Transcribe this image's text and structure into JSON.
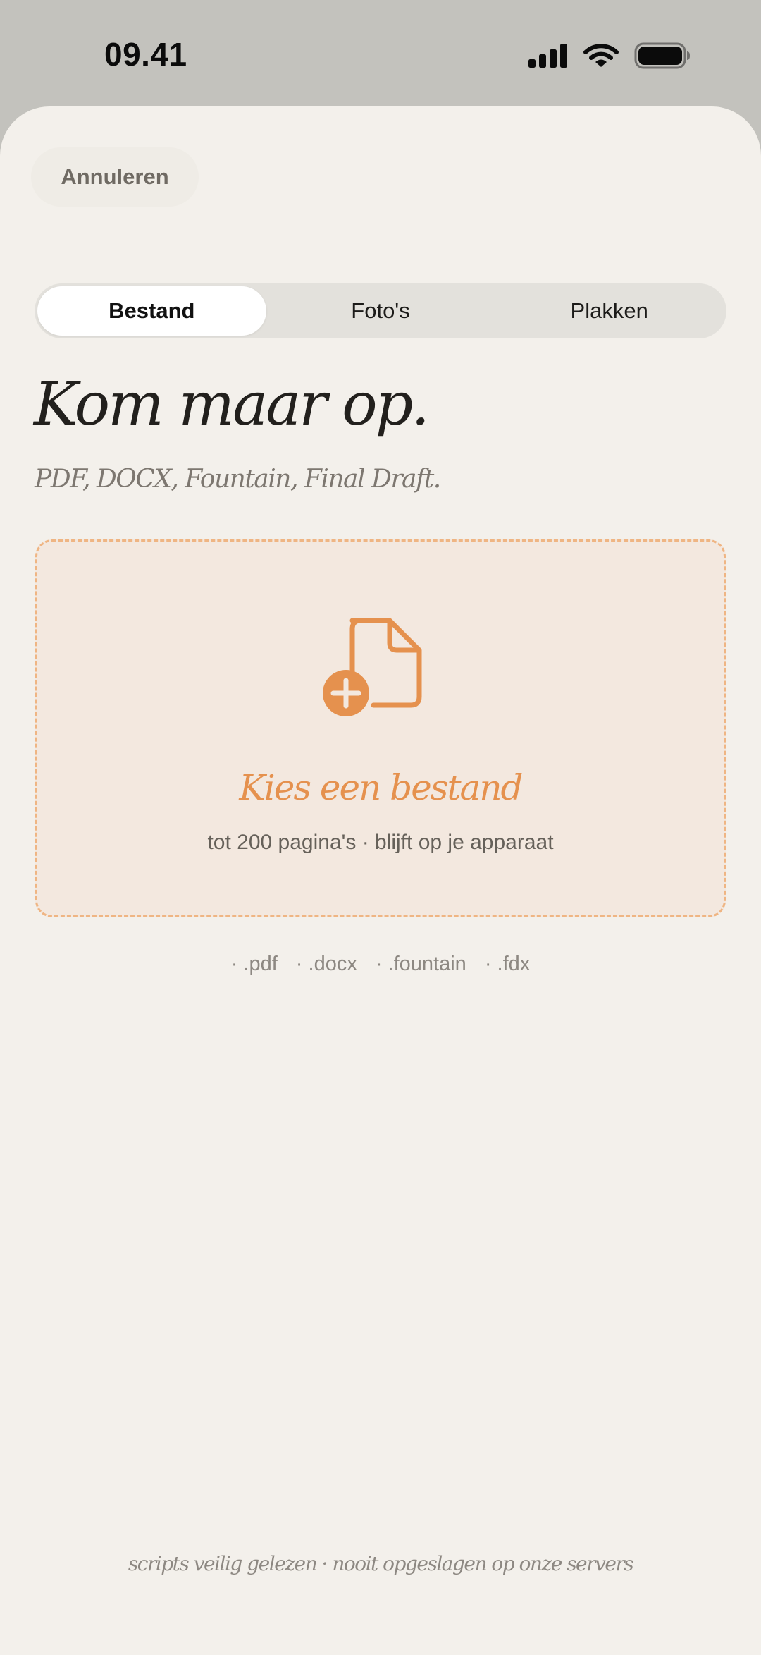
{
  "status_bar": {
    "time": "09.41",
    "icons": [
      "cellular-signal-icon",
      "wifi-icon",
      "battery-icon"
    ]
  },
  "header": {
    "cancel_label": "Annuleren"
  },
  "tabs": [
    {
      "label": "Bestand",
      "active": true
    },
    {
      "label": "Foto's",
      "active": false
    },
    {
      "label": "Plakken",
      "active": false
    }
  ],
  "main": {
    "title": "Kom maar op.",
    "subtitle": "PDF, DOCX, Fountain, Final Draft."
  },
  "dropzone": {
    "icon": "file-add-icon",
    "title": "Kies een bestand",
    "subtitle": "tot 200 pagina's · blijft op je apparaat"
  },
  "formats": [
    "· .pdf",
    "· .docx",
    "· .fountain",
    "· .fdx"
  ],
  "footer": {
    "note": "scripts veilig gelezen · nooit opgeslagen op onze servers"
  },
  "colors": {
    "accent": "#e5914e",
    "sheet_background": "#f3f0eb",
    "dropzone_border": "#efb583",
    "dropzone_background": "#f3e8df"
  }
}
